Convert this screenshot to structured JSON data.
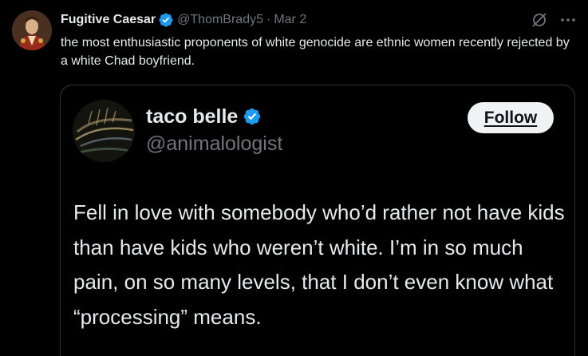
{
  "tweet": {
    "author_name": "Fugitive Caesar",
    "author_handle": "@ThomBrady5",
    "separator": "·",
    "date": "Mar 2",
    "text": "the most enthusiastic proponents of white genocide are ethnic women recently rejected by a white Chad boyfriend."
  },
  "quote": {
    "author_name": "taco belle",
    "author_handle": "@animalologist",
    "follow_label": "Follow",
    "text": "Fell in love with somebody who’d rather not have kids than have kids who weren’t white. I’m in so much pain, on so many levels, that I don’t even know what “processing” means."
  },
  "icons": [
    "verified-icon",
    "grok-icon",
    "more-icon"
  ],
  "colors": {
    "background": "#000000",
    "text": "#e7e9ea",
    "muted": "#71767b",
    "verified": "#1d9bf0",
    "border": "#2f3336",
    "button_bg": "#eff3f4"
  }
}
